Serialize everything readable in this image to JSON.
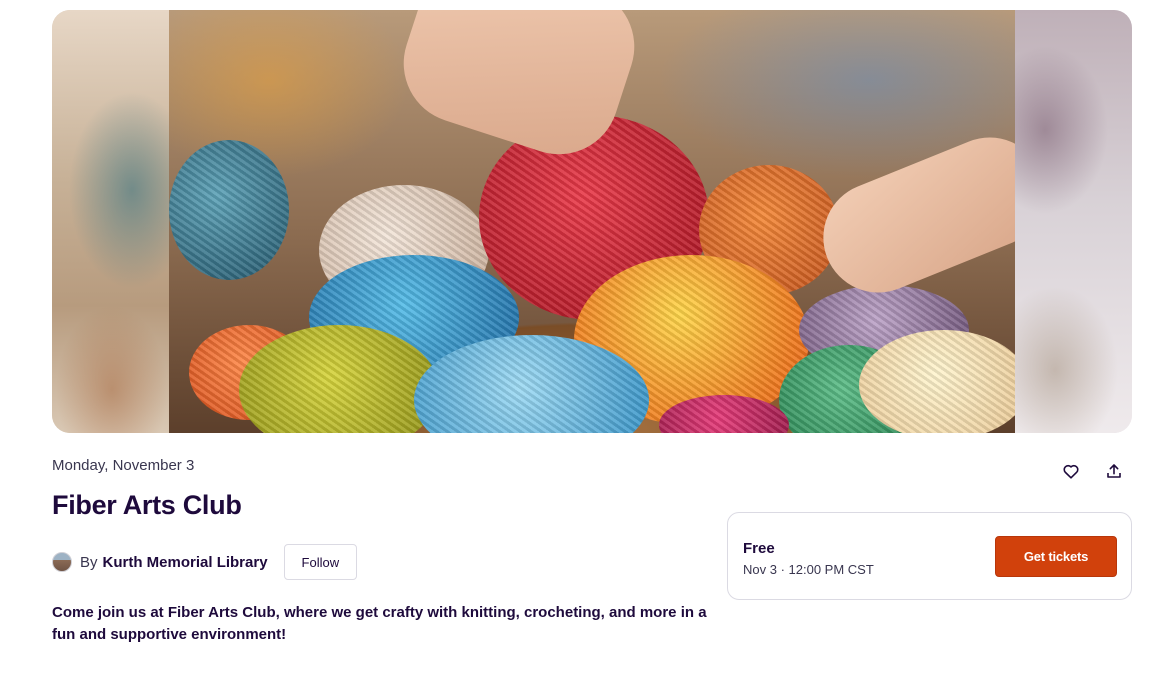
{
  "hero": {
    "image_alt": "Hands arranging colorful balls of yarn in a wooden basket"
  },
  "event": {
    "date": "Monday, November 3",
    "title": "Fiber Arts Club",
    "description": "Come join us at Fiber Arts Club, where we get crafty with knitting, crocheting, and more in a fun and supportive environment!"
  },
  "organizer": {
    "prefix": "By",
    "name": "Kurth Memorial Library",
    "follow_label": "Follow"
  },
  "actions": {
    "like_icon": "heart-icon",
    "share_icon": "share-icon"
  },
  "ticket": {
    "price": "Free",
    "when": "Nov 3 · 12:00 PM CST",
    "cta_label": "Get tickets"
  },
  "colors": {
    "accent": "#d1410c",
    "text_primary": "#1e0a3c",
    "text_secondary": "#39364f",
    "border": "#dbdae3"
  }
}
